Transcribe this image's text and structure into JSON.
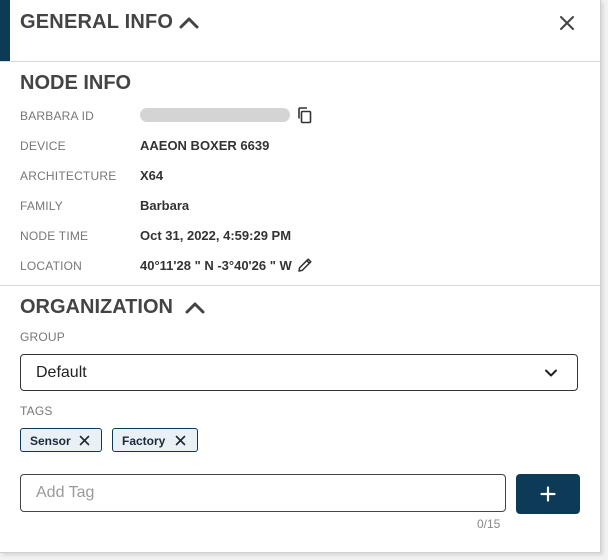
{
  "header": {
    "title": "GENERAL INFO",
    "collapse_icon": "chevron-up-icon",
    "close_icon": "close-icon"
  },
  "node_info": {
    "title": "NODE INFO",
    "rows": [
      {
        "label": "BARBARA ID",
        "value": ""
      },
      {
        "label": "DEVICE",
        "value": "AAEON BOXER 6639"
      },
      {
        "label": "ARCHITECTURE",
        "value": "X64"
      },
      {
        "label": "FAMILY",
        "value": "Barbara"
      },
      {
        "label": "NODE TIME",
        "value": "Oct 31, 2022, 4:59:29 PM"
      },
      {
        "label": "LOCATION",
        "value": "40°11'28 \" N -3°40'26 \" W"
      }
    ]
  },
  "organization": {
    "title": "ORGANIZATION",
    "group_label": "GROUP",
    "group_value": "Default",
    "tags_label": "TAGS",
    "tags": [
      "Sensor",
      "Factory"
    ],
    "add_tag_placeholder": "Add Tag",
    "add_tag_value": "",
    "counter": "0/15"
  },
  "colors": {
    "accent": "#0d3a56",
    "tag_bg": "#e9f1f7"
  }
}
